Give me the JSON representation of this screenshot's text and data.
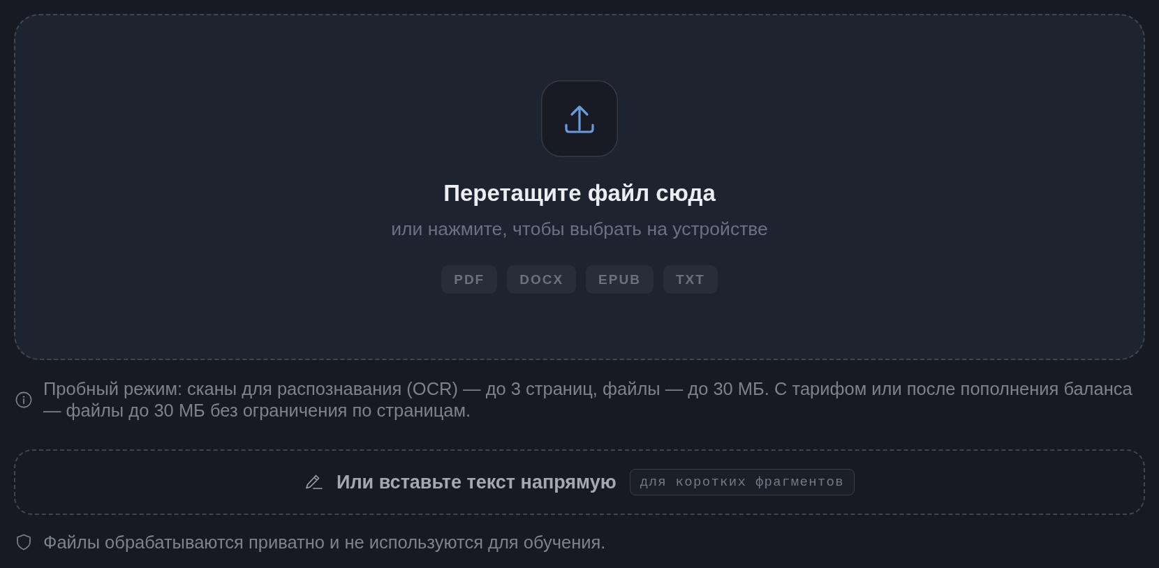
{
  "dropzone": {
    "title": "Перетащите файл сюда",
    "subtitle": "или нажмите, чтобы выбрать на устройстве",
    "formats": [
      "PDF",
      "DOCX",
      "EPUB",
      "TXT"
    ]
  },
  "notice": {
    "text": "Пробный режим: сканы для распознавания (OCR) — до 3 страниц, файлы — до 30 МБ. С тарифом или после пополнения баланса — файлы до 30 МБ без ограничения по страницам."
  },
  "paste": {
    "label": "Или вставьте текст напрямую",
    "hint": "для коротких фрагментов"
  },
  "privacy": {
    "text": "Файлы обрабатываются приватно и не используются для обучения."
  }
}
